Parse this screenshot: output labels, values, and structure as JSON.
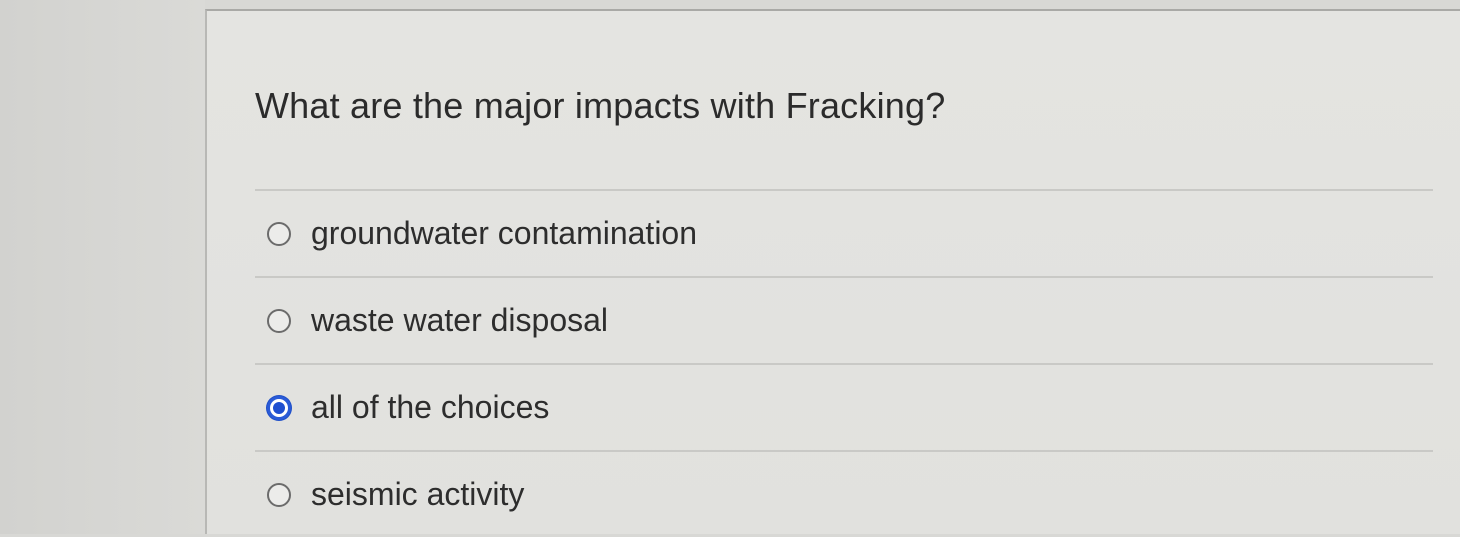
{
  "question": {
    "text": "What are the major impacts with Fracking?"
  },
  "answers": [
    {
      "label": "groundwater contamination",
      "selected": false
    },
    {
      "label": "waste water disposal",
      "selected": false
    },
    {
      "label": "all of the choices",
      "selected": true
    },
    {
      "label": "seismic activity",
      "selected": false
    }
  ],
  "colors": {
    "radio_selected": "#1f4fd0",
    "text": "#2d2d2d"
  }
}
